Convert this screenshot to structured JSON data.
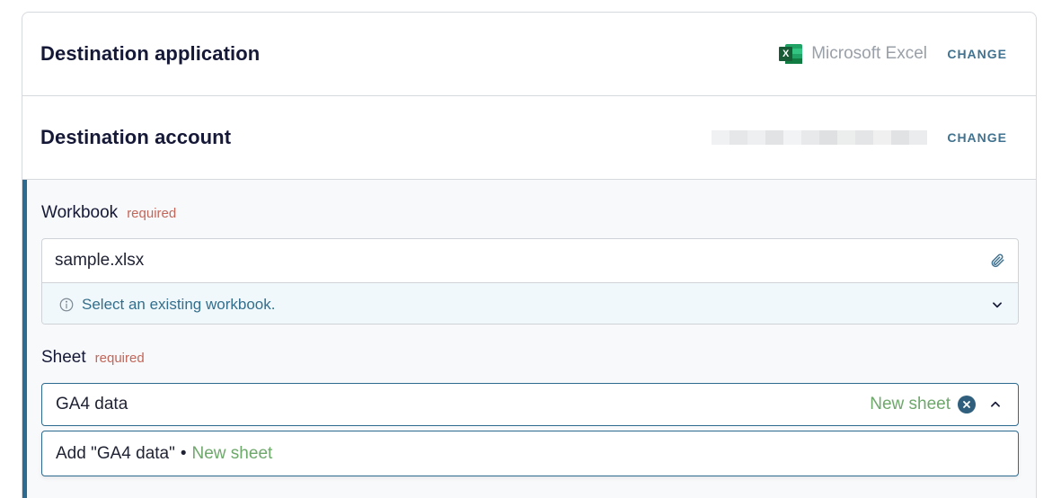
{
  "destination_app": {
    "title": "Destination application",
    "app_name": "Microsoft Excel",
    "icon": "excel-icon",
    "change_label": "CHANGE"
  },
  "destination_account": {
    "title": "Destination account",
    "change_label": "CHANGE"
  },
  "workbook": {
    "label": "Workbook",
    "required": "required",
    "value": "sample.xlsx",
    "hint": "Select an existing workbook."
  },
  "sheet": {
    "label": "Sheet",
    "required": "required",
    "value": "GA4 data",
    "tag": "New sheet"
  },
  "dropdown": {
    "option_prefix": "Add \"GA4 data\"",
    "bullet": "•",
    "option_tag": "New sheet"
  },
  "colors": {
    "accent": "#2d6a8f",
    "change_link": "#41728f",
    "required": "#c2665a",
    "new_sheet": "#6ea86b"
  }
}
